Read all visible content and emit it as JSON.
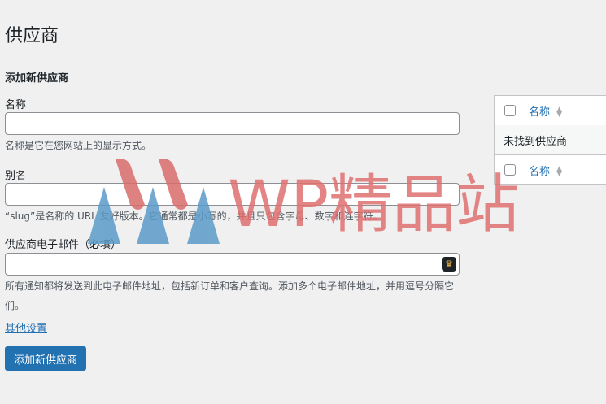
{
  "page": {
    "title": "供应商"
  },
  "form": {
    "heading": "添加新供应商",
    "name": {
      "label": "名称",
      "value": "",
      "description": "名称是它在您网站上的显示方式。"
    },
    "slug": {
      "label": "别名",
      "value": "",
      "description": "“slug”是名称的 URL 友好版本。它通常都是小写的，并且只包含字母、数字和连字符。"
    },
    "email": {
      "label": "供应商电子邮件（必填）",
      "value": "",
      "description": "所有通知都将发送到此电子邮件地址，包括新订单和客户查询。添加多个电子邮件地址，并用逗号分隔它们。"
    },
    "other_settings_link": "其他设置",
    "submit_label": "添加新供应商"
  },
  "list_table": {
    "column_name": "名称",
    "empty_message": "未找到供应商"
  },
  "watermark": {
    "text": "WP精品站",
    "text_color": "#e07070",
    "logo_red": "#d96c6c",
    "logo_blue": "#5b9bc8"
  },
  "colors": {
    "accent": "#2271b1",
    "background": "#f0f0f1",
    "text": "#1d2327"
  }
}
